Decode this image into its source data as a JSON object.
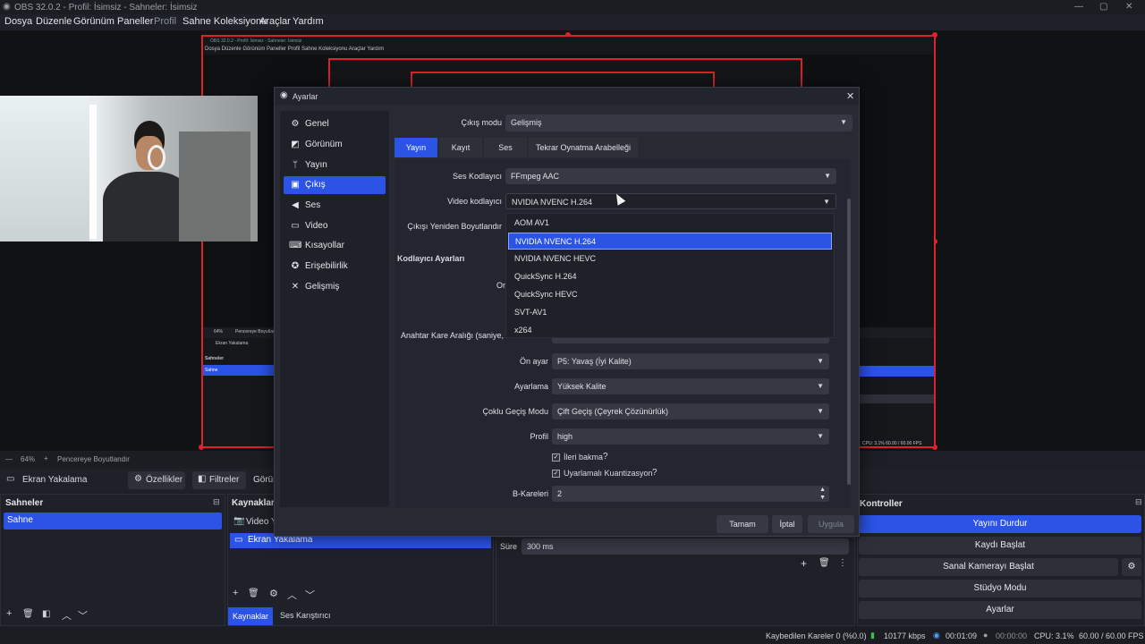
{
  "titlebar": {
    "title": "OBS 32.0.2 - Profil: İsimsiz - Sahneler: İsimsiz"
  },
  "menu": [
    {
      "label": "Dosya"
    },
    {
      "label": "Düzenle"
    },
    {
      "label": "Görünüm"
    },
    {
      "label": "Paneller"
    },
    {
      "label": "Profil"
    },
    {
      "label": "Sahne Koleksiyonu"
    },
    {
      "label": "Araçlar"
    },
    {
      "label": "Yardım"
    }
  ],
  "preview": {
    "nested_title": "OBS 32.0.2 - Profil: İsimsiz - Sahneler: İsimsiz",
    "nested_menu": "Dosya  Düzenle  Görünüm  Paneller  Profil  Sahne Koleksiyonu  Araçlar  Yardım",
    "nested_sources": "Ekran Yakalama",
    "nested_scenes": "Sahneler",
    "nested_scene": "Sahne",
    "nested_cpu": "CPU: 3.1%   60.00 / 60.00 FPS",
    "zoom": "64%",
    "resize": "Pencereye Boyutlandır",
    "nested_zoom": "64%",
    "nested_resize": "Pencereye Boyutlandır"
  },
  "toolbar": {
    "source_name": "Ekran Yakalama",
    "properties": "Özellikler",
    "filters": "Filtreler",
    "more": "Görün"
  },
  "scenes": {
    "title": "Sahneler",
    "items": [
      "Sahne"
    ]
  },
  "sources": {
    "title": "Kaynaklar",
    "items": [
      "Video Ya",
      "Ekran Yakalama"
    ]
  },
  "transition": {
    "label": "Süre",
    "value": "300 ms"
  },
  "tabs_bottom": {
    "sources": "Kaynaklar",
    "mixer": "Ses Karıştırıcı"
  },
  "controls": {
    "title": "Kontroller",
    "stop_stream": "Yayını Durdur",
    "start_record": "Kaydı Başlat",
    "virtual_cam": "Sanal Kamerayı Başlat",
    "studio": "Stüdyo Modu",
    "settings": "Ayarlar"
  },
  "status": {
    "dropped": "Kaybedilen Kareler 0 (%0.0)",
    "bitrate": "10177 kbps",
    "stream_time": "00:01:09",
    "record_time": "00:00:00",
    "cpu": "CPU: 3.1%",
    "fps": "60.00 / 60.00 FPS"
  },
  "settings": {
    "title": "Ayarlar",
    "sidebar": [
      {
        "label": "Genel",
        "icon": "gear-icon"
      },
      {
        "label": "Görünüm",
        "icon": "appearance-icon"
      },
      {
        "label": "Yayın",
        "icon": "antenna-icon"
      },
      {
        "label": "Çıkış",
        "icon": "output-icon"
      },
      {
        "label": "Ses",
        "icon": "speaker-icon"
      },
      {
        "label": "Video",
        "icon": "monitor-icon"
      },
      {
        "label": "Kısayollar",
        "icon": "keyboard-icon"
      },
      {
        "label": "Erişebilirlik",
        "icon": "accessibility-icon"
      },
      {
        "label": "Gelişmiş",
        "icon": "wrench-icon"
      }
    ],
    "output_mode_label": "Çıkış modu",
    "output_mode_value": "Gelişmiş",
    "tabs": [
      "Yayın",
      "Kayıt",
      "Ses",
      "Tekrar Oynatma Arabelleği"
    ],
    "audio_encoder_label": "Ses Kodlayıcı",
    "audio_encoder_value": "FFmpeg AAC",
    "video_encoder_label": "Video kodlayıcı",
    "video_encoder_value": "NVIDIA NVENC H.264",
    "rescale_label": "Çıkışı Yeniden Boyutlandır",
    "encoder_settings_header": "Kodlayıcı Ayarları",
    "partial_label": "Or",
    "keyframe_label": "Anahtar Kare Aralığı (saniye,",
    "dropdown_options": [
      "AOM AV1",
      "NVIDIA NVENC H.264",
      "NVIDIA NVENC HEVC",
      "QuickSync H.264",
      "QuickSync HEVC",
      "SVT-AV1",
      "x264"
    ],
    "dropdown_selected_index": 1,
    "preset_label": "Ön ayar",
    "preset_value": "P5: Yavaş (İyi Kalite)",
    "tuning_label": "Ayarlama",
    "tuning_value": "Yüksek Kalite",
    "multipass_label": "Çoklu Geçiş Modu",
    "multipass_value": "Çift Geçiş (Çeyrek Çözünürlük)",
    "profile_label": "Profil",
    "profile_value": "high",
    "lookahead_label": "İleri bakma",
    "aq_label": "Uyarlamalı Kuantizasyon",
    "bframes_label": "B-Kareleri",
    "bframes_value": "2",
    "ok": "Tamam",
    "cancel": "İptal",
    "apply": "Uygula"
  }
}
